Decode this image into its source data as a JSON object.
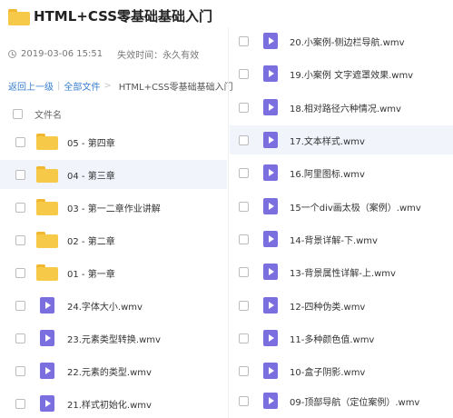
{
  "header": {
    "icon": "folder-icon",
    "title": "HTML+CSS零基础基础入门"
  },
  "meta": {
    "icon": "clock-icon",
    "date": "2019-03-06 15:51",
    "expire": "失效时间：永久有效"
  },
  "breadcrumb": {
    "back": "返回上一级",
    "separator": "|",
    "all_files": "全部文件",
    "arrow": ">",
    "current": "HTML+CSS零基础基础入门"
  },
  "column_header": "文件名",
  "colors": {
    "link": "#3a7fcf",
    "folder": "#f7c948",
    "video": "#7b6fe0",
    "highlight": "#f1f5fb"
  },
  "left_files": [
    {
      "name": "05 - 第四章",
      "type": "folder"
    },
    {
      "name": "04 - 第三章",
      "type": "folder"
    },
    {
      "name": "03 - 第一二章作业讲解",
      "type": "folder"
    },
    {
      "name": "02 - 第二章",
      "type": "folder"
    },
    {
      "name": "01 - 第一章",
      "type": "folder"
    },
    {
      "name": "24.字体大小.wmv",
      "type": "video"
    },
    {
      "name": "23.元素类型转换.wmv",
      "type": "video"
    },
    {
      "name": "22.元素的类型.wmv",
      "type": "video"
    },
    {
      "name": "21.样式初始化.wmv",
      "type": "video"
    }
  ],
  "right_files": [
    {
      "name": "20.小案例-侧边栏导航.wmv",
      "type": "video"
    },
    {
      "name": "19.小案例 文字遮罩效果.wmv",
      "type": "video"
    },
    {
      "name": "18.相对路径六种情况.wmv",
      "type": "video"
    },
    {
      "name": "17.文本样式.wmv",
      "type": "video"
    },
    {
      "name": "16.阿里图标.wmv",
      "type": "video"
    },
    {
      "name": "15一个div画太极（案例）.wmv",
      "type": "video"
    },
    {
      "name": "14-背景详解-下.wmv",
      "type": "video"
    },
    {
      "name": "13-背景属性详解-上.wmv",
      "type": "video"
    },
    {
      "name": "12-四种伪类.wmv",
      "type": "video"
    },
    {
      "name": "11-多种颜色值.wmv",
      "type": "video"
    },
    {
      "name": "10-盒子阴影.wmv",
      "type": "video"
    },
    {
      "name": "09-顶部导航（定位案例）.wmv",
      "type": "video"
    }
  ]
}
